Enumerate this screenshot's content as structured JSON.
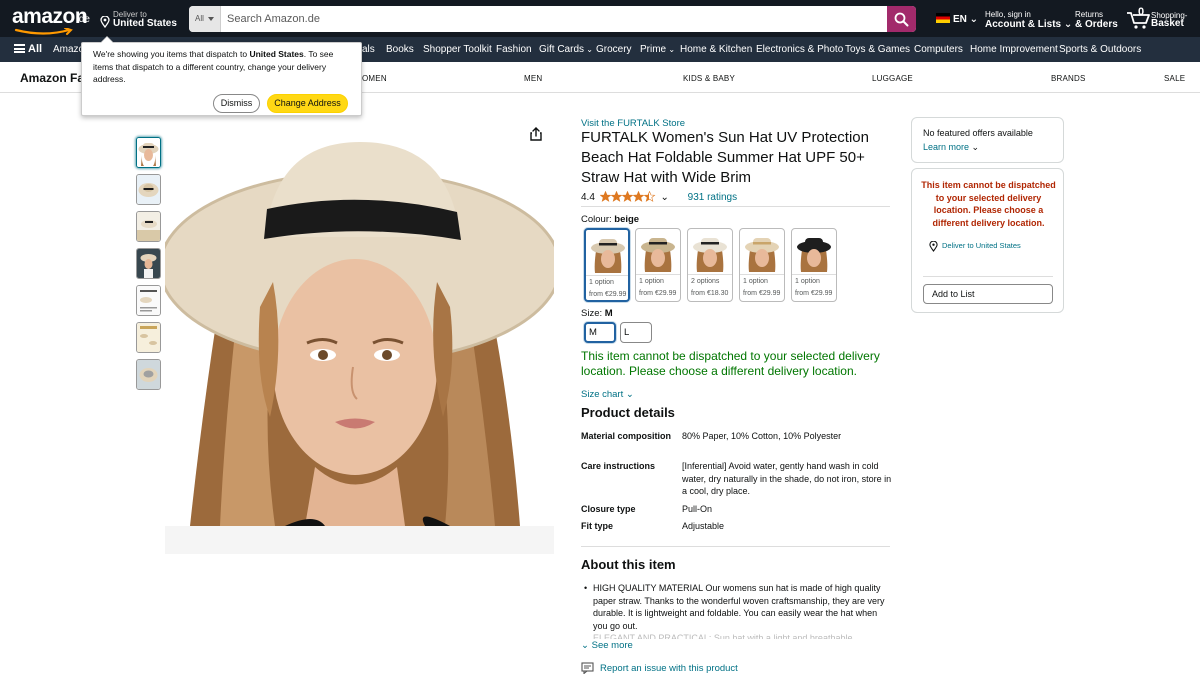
{
  "header": {
    "logo_word": "amazon",
    "logo_tld": ".de",
    "deliver_line1": "Deliver to",
    "deliver_line2": "United States",
    "search_category": "All",
    "search_placeholder": "Search Amazon.de",
    "language": "EN",
    "account_line1": "Hello, sign in",
    "account_line2": "Account & Lists",
    "returns_line1": "Returns",
    "returns_line2": "& Orders",
    "basket_count": "0",
    "basket_line1": "Shopping-",
    "basket_line2": "Basket"
  },
  "nav": {
    "all_label": "All",
    "items": [
      "Amazo",
      "als",
      "Books",
      "Shopper Toolkit",
      "Fashion",
      "Gift Cards",
      "Grocery",
      "Prime",
      "Home & Kitchen",
      "Electronics & Photo",
      "Toys & Games",
      "Computers",
      "Home Improvement",
      "Sports & Outdoors"
    ]
  },
  "subnav": {
    "brand": "Amazon Fa",
    "items": [
      "OMEN",
      "MEN",
      "KIDS & BABY",
      "LUGGAGE",
      "BRANDS",
      "SALE"
    ]
  },
  "popover": {
    "message_pre": "We're showing you items that dispatch to ",
    "message_bold": "United States",
    "message_post": ". To see items that dispatch to a different country, change your delivery address.",
    "dismiss": "Dismiss",
    "change": "Change Address"
  },
  "product": {
    "store_link": "Visit the FURTALK Store",
    "title": "FURTALK Women's Sun Hat UV Protection Beach Hat Foldable Summer Hat UPF 50+ Straw Hat with Wide Brim",
    "rating": "4.4",
    "rating_count": "931 ratings",
    "colour_label": "Colour: ",
    "colour_value": "beige",
    "swatches": [
      {
        "options": "1 option",
        "price": "from €29.99",
        "hat": "#d8c9b0"
      },
      {
        "options": "1 option",
        "price": "from €29.99",
        "hat": "#c9b58f"
      },
      {
        "options": "2 options",
        "price": "from €18.30",
        "hat": "#e9e2d4"
      },
      {
        "options": "1 option",
        "price": "from €29.99",
        "hat": "#e4d3b5"
      },
      {
        "options": "1 option",
        "price": "from €29.99",
        "hat": "#1e1e1e"
      }
    ],
    "size_label": "Size: ",
    "size_value": "M",
    "sizes": [
      "M",
      "L"
    ],
    "unavailable_msg": "This item cannot be dispatched to your selected delivery location. Please choose a different delivery location.",
    "size_chart": "Size chart",
    "details_heading": "Product details",
    "details": [
      {
        "k": "Material composition",
        "v": "80% Paper, 10% Cotton, 10% Polyester"
      },
      {
        "k": "Care instructions",
        "v": "[Inferential] Avoid water, gently hand wash in cold water, dry naturally in the shade, do not iron, store in a cool, dry place."
      },
      {
        "k": "Closure type",
        "v": "Pull-On"
      },
      {
        "k": "Fit type",
        "v": "Adjustable"
      }
    ],
    "about_heading": "About this item",
    "about_item": "HIGH QUALITY MATERIAL Our womens sun hat is made of high quality paper straw. Thanks to the wonderful woven craftsmanship, they are very durable. It is lightweight and foldable. You can easily wear the hat when you go out.",
    "about_next": "ELEGANT AND PRACTICAL: Sun hat with a light and breathable",
    "see_more": "See more",
    "report": "Report an issue with this product"
  },
  "buybox": {
    "no_offers": "No featured offers available",
    "learn_more": "Learn more",
    "warning": "This item cannot be dispatched to your selected delivery location. Please choose a different delivery location.",
    "deliver_to": "Deliver to United States",
    "add_to_list": "Add to List"
  },
  "colors": {
    "nav_dark": "#131921",
    "nav_main": "#232f3e",
    "search_button": "#a22a6b",
    "link": "#007185",
    "success": "#007600",
    "warning": "#b12704",
    "star": "#de7921",
    "button_yellow": "#ffd814"
  }
}
